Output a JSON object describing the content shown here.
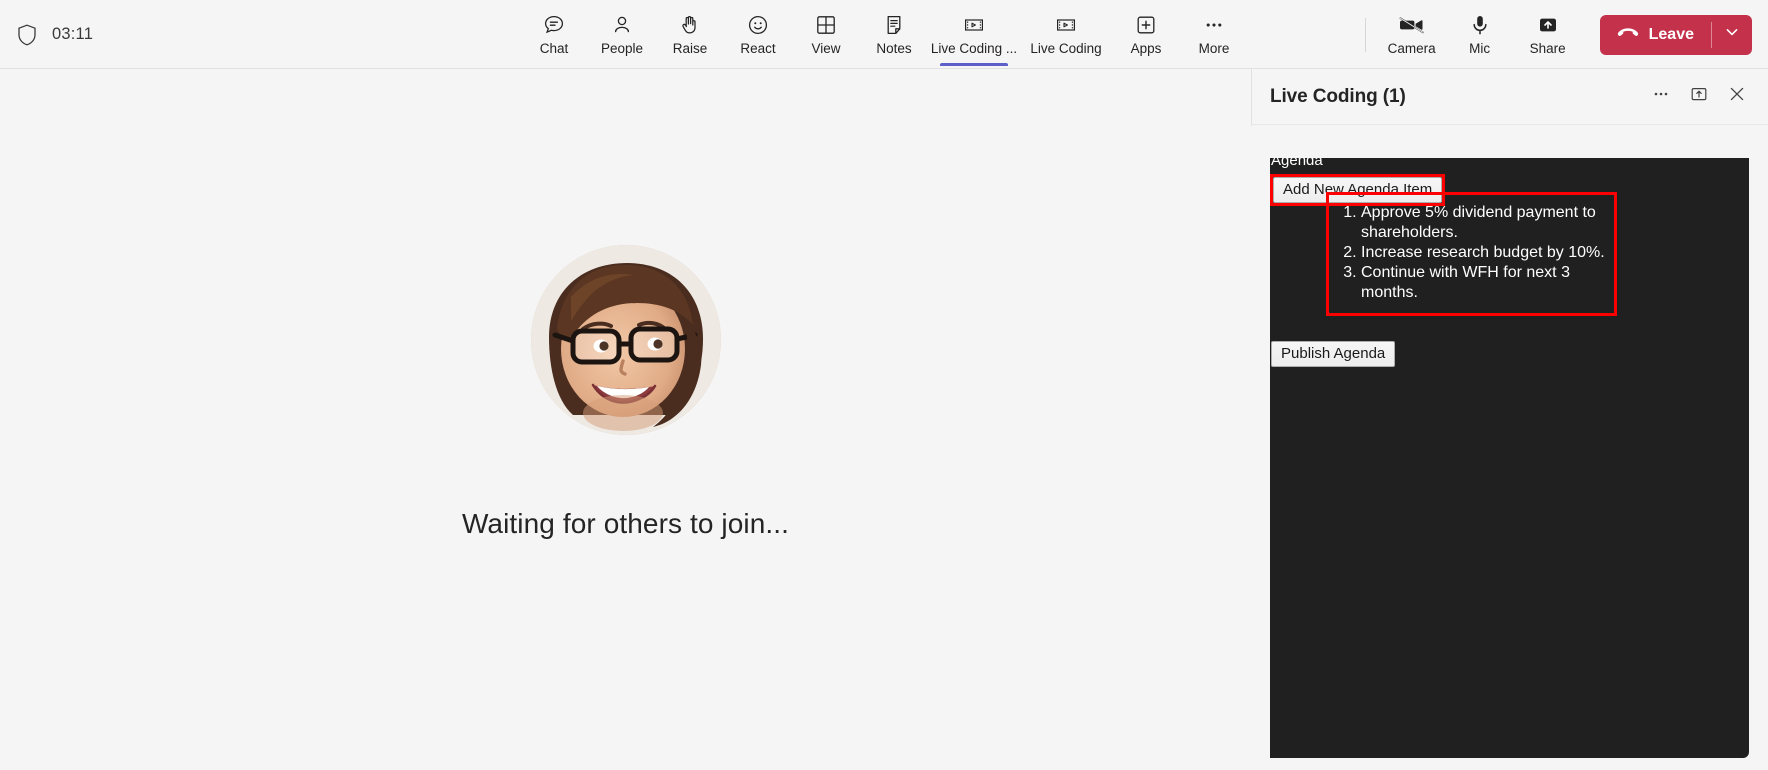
{
  "topbar": {
    "shield_icon": "shield-icon",
    "timer": "03:11",
    "tools": [
      {
        "id": "chat",
        "label": "Chat",
        "icon": "chat-icon",
        "active": false
      },
      {
        "id": "people",
        "label": "People",
        "icon": "people-icon",
        "active": false
      },
      {
        "id": "raise",
        "label": "Raise",
        "icon": "raise-hand-icon",
        "active": false
      },
      {
        "id": "react",
        "label": "React",
        "icon": "react-smiley-icon",
        "active": false
      },
      {
        "id": "view",
        "label": "View",
        "icon": "view-grid-icon",
        "active": false
      },
      {
        "id": "notes",
        "label": "Notes",
        "icon": "notes-icon",
        "active": false
      },
      {
        "id": "livecoding1",
        "label": "Live Coding ...",
        "icon": "live-coding-icon",
        "active": true
      },
      {
        "id": "livecoding2",
        "label": "Live Coding",
        "icon": "live-coding-icon",
        "active": false
      },
      {
        "id": "apps",
        "label": "Apps",
        "icon": "apps-plus-icon",
        "active": false
      },
      {
        "id": "more",
        "label": "More",
        "icon": "more-ellipsis-icon",
        "active": false
      }
    ],
    "call_controls": [
      {
        "id": "camera",
        "label": "Camera",
        "icon": "camera-off-icon"
      },
      {
        "id": "mic",
        "label": "Mic",
        "icon": "microphone-icon"
      },
      {
        "id": "share",
        "label": "Share",
        "icon": "share-up-arrow-icon"
      }
    ],
    "leave": {
      "label": "Leave",
      "icon": "hangup-phone-icon",
      "caret_icon": "chevron-down-icon",
      "color": "#c4314b"
    }
  },
  "stage": {
    "avatar_name": "participant-avatar",
    "waiting_text": "Waiting for others to join..."
  },
  "panel": {
    "title": "Live Coding (1)",
    "actions": [
      {
        "id": "more",
        "icon": "more-ellipsis-icon"
      },
      {
        "id": "popout",
        "icon": "pop-out-icon"
      },
      {
        "id": "close",
        "icon": "close-x-icon"
      }
    ],
    "app": {
      "agenda_label": "Agenda",
      "add_button": "Add New Agenda Item",
      "publish_button": "Publish Agenda",
      "items": [
        "Approve 5% dividend payment to shareholders.",
        "Increase research budget by 10%.",
        "Continue with WFH for next 3 months."
      ],
      "highlight_color": "#ff0000",
      "background": "#202020"
    }
  }
}
